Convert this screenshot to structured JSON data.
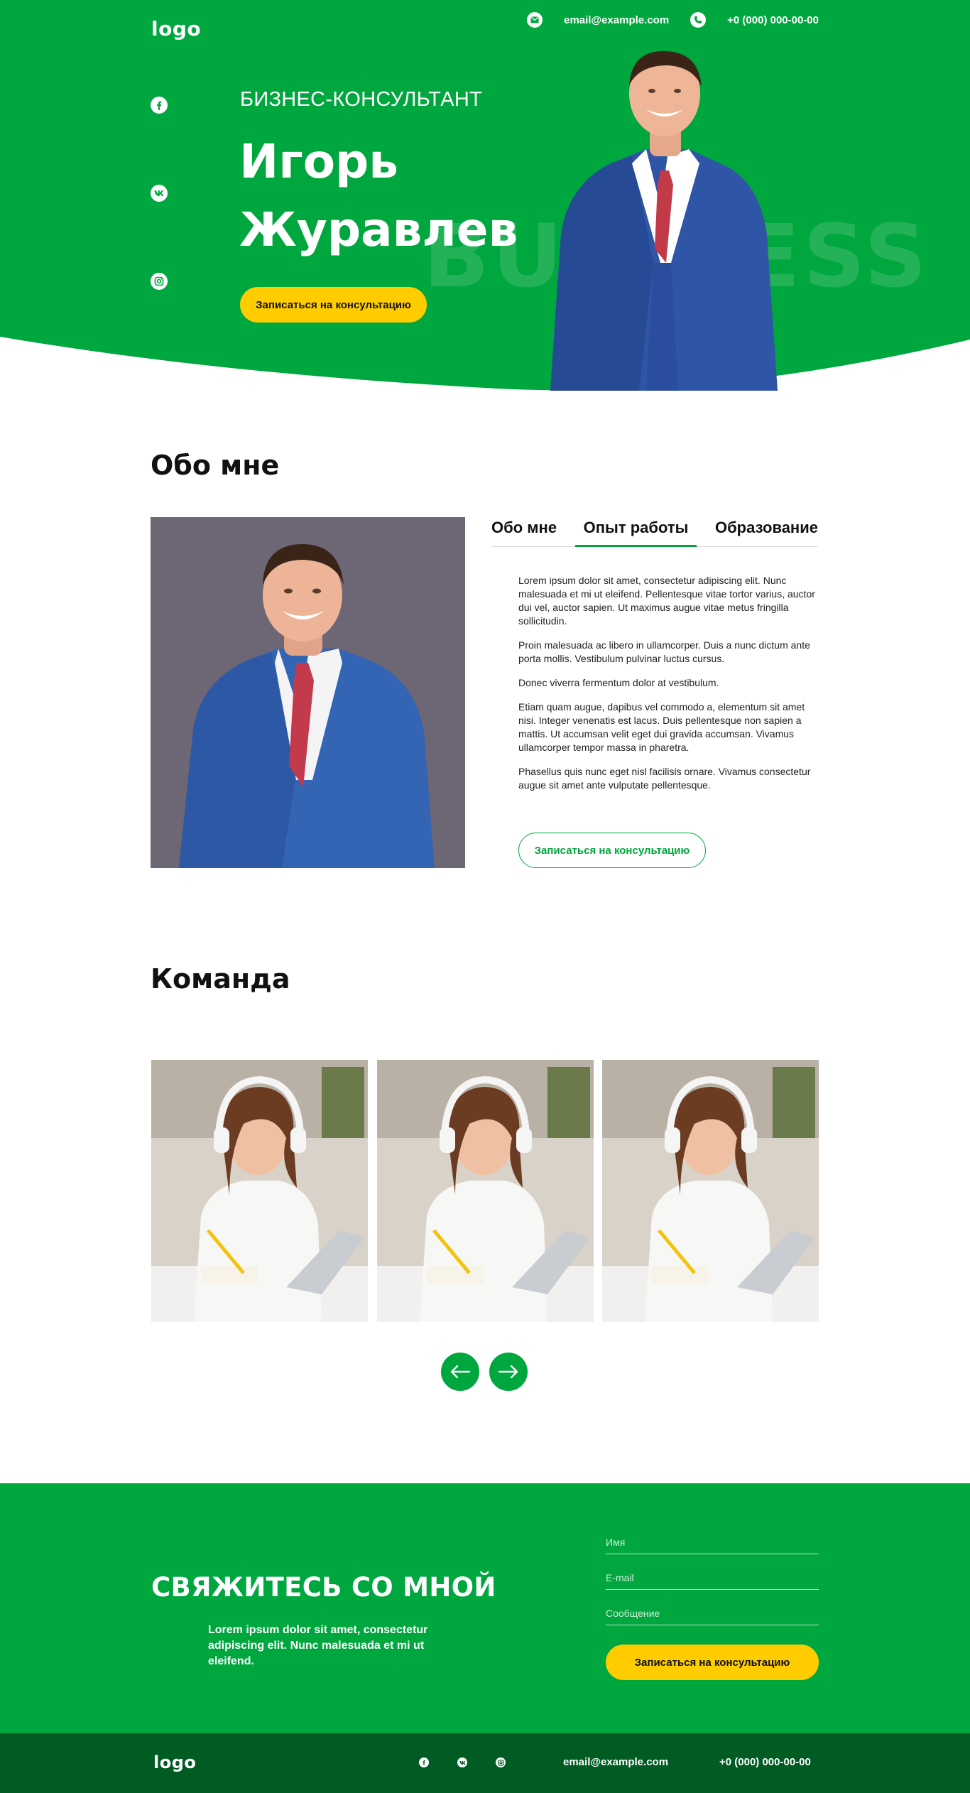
{
  "header": {
    "logo": "logo",
    "email": "email@example.com",
    "phone": "+0 (000) 000-00-00"
  },
  "hero": {
    "subtitle": "БИЗНЕС-КОНСУЛЬТАНТ",
    "name_line1": "Игорь",
    "name_line2": "Журавлев",
    "cta": "Записаться на консультацию",
    "background_word": "BUSINESS",
    "social": [
      "facebook-icon",
      "vk-icon",
      "instagram-icon"
    ]
  },
  "about": {
    "title": "Обо мне",
    "tabs": [
      {
        "label": "Обо мне",
        "active": false
      },
      {
        "label": "Опыт работы",
        "active": true
      },
      {
        "label": "Образование",
        "active": false
      }
    ],
    "paragraphs": [
      "Lorem ipsum dolor sit amet, consectetur adipiscing elit. Nunc malesuada et mi ut eleifend. Pellentesque vitae tortor varius, auctor dui vel, auctor sapien. Ut maximus augue vitae metus fringilla sollicitudin.",
      "Proin malesuada ac libero in ullamcorper. Duis a nunc dictum ante porta mollis. Vestibulum pulvinar luctus cursus.",
      "Donec viverra fermentum dolor at vestibulum.",
      "Etiam quam augue, dapibus vel commodo a, elementum sit amet nisi. Integer venenatis est lacus. Duis pellentesque non sapien a mattis. Ut accumsan velit eget dui gravida accumsan. Vivamus ullamcorper tempor massa in pharetra.",
      "Phasellus quis nunc eget nisl facilisis ornare. Vivamus consectetur augue sit amet ante vulputate pellentesque."
    ],
    "cta": "Записаться на консультацию"
  },
  "team": {
    "title": "Команда",
    "members_count": 3,
    "prev_icon": "arrow-left-icon",
    "next_icon": "arrow-right-icon"
  },
  "contact": {
    "title": "СВЯЖИТЕСЬ СО МНОЙ",
    "description": "Lorem ipsum dolor sit amet, consectetur adipiscing elit. Nunc malesuada et mi ut eleifend.",
    "fields": {
      "name_placeholder": "Имя",
      "email_placeholder": "E-mail",
      "message_placeholder": "Сообщение"
    },
    "cta": "Записаться на консультацию"
  },
  "footer": {
    "logo": "logo",
    "email": "email@example.com",
    "phone": "+0 (000) 000-00-00"
  },
  "colors": {
    "brand_green": "#00a63e",
    "footer_green": "#005c23",
    "accent_yellow": "#ffcc00"
  }
}
